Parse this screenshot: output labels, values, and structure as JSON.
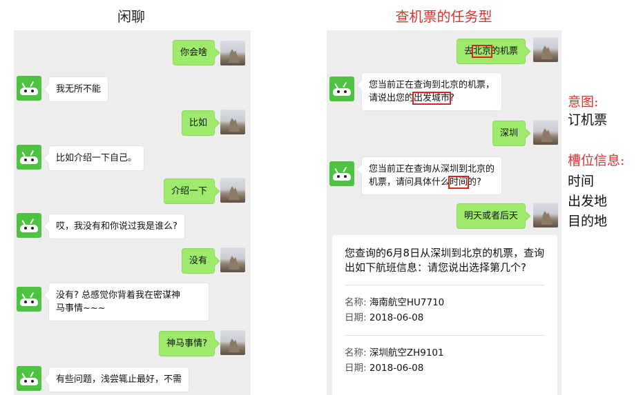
{
  "left_title": "闲聊",
  "right_title": "查机票的任务型",
  "left_chat": {
    "m1": "你会啥",
    "m2": "我无所不能",
    "m3": "比如",
    "m4": "比如介绍一下自己。",
    "m5": "介绍一下",
    "m6": "哎，我没有和你说过我是谁么?",
    "m7": "没有",
    "m8a": "没有? 总感觉你背着我在密谋神",
    "m8b": "马事情~~~",
    "m9": "神马事情?",
    "m10": "有些问题，浅尝辄止最好，不需"
  },
  "right_chat": {
    "u1_pre": "去",
    "u1_hl": "北京",
    "u1_post": "的机票",
    "b1_line1": "您当前正在查询到北京的机票，",
    "b1_pre": "请说出您的",
    "b1_hl": "出发城市",
    "b1_post": "?",
    "u2": "深圳",
    "b2_line1": "您当前正在查询从深圳到北京的",
    "b2_pre": "机票，请问具体什么",
    "b2_hl": "时间",
    "b2_post": "的?",
    "u3": "明天或者后天",
    "card_msg": "您查询的6月8日从深圳到北京的机票，查询出如下航班信息：请您说出选择第几个?",
    "flights": [
      {
        "name_label": "名称:",
        "name": "海南航空HU7710",
        "date_label": "日期:",
        "date": "2018-06-08"
      },
      {
        "name_label": "名称:",
        "name": "深圳航空ZH9101",
        "date_label": "日期:",
        "date": "2018-06-08"
      }
    ]
  },
  "annotations": {
    "intent_label": "意图:",
    "intent_value": "订机票",
    "slot_label": "槽位信息:",
    "slots": [
      "时间",
      "出发地",
      "目的地"
    ]
  },
  "colors": {
    "title_red": "#e03030",
    "bubble_green": "#9eea6a",
    "bot_green": "#4ec342",
    "highlight": "#e02020"
  }
}
